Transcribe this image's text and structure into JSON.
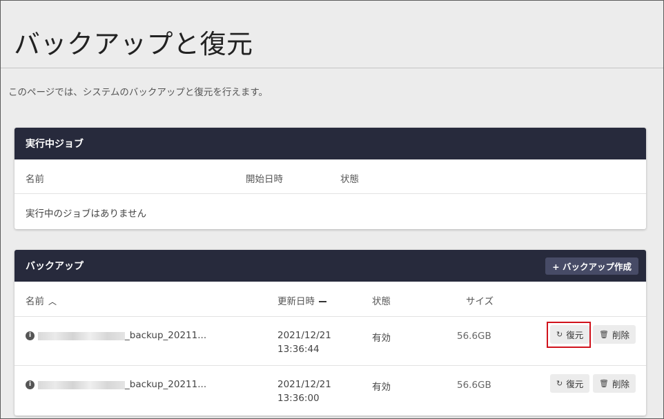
{
  "page": {
    "title": "バックアップと復元",
    "description": "このページでは、システムのバックアップと復元を行えます。"
  },
  "jobs_panel": {
    "title": "実行中ジョブ",
    "columns": [
      "名前",
      "開始日時",
      "状態"
    ],
    "empty_message": "実行中のジョブはありません"
  },
  "backups_panel": {
    "title": "バックアップ",
    "create_button": "+ バックアップ作成",
    "columns": {
      "name": "名前",
      "updated": "更新日時",
      "status": "状態",
      "size": "サイズ"
    },
    "rows": [
      {
        "name_suffix": "_backup_20211...",
        "date": "2021/12/21",
        "time": "13:36:44",
        "status": "有効",
        "size": "56.6GB",
        "restore_label": "復元",
        "delete_label": "削除"
      },
      {
        "name_suffix": "_backup_20211...",
        "date": "2021/12/21",
        "time": "13:36:00",
        "status": "有効",
        "size": "56.6GB",
        "restore_label": "復元",
        "delete_label": "削除"
      }
    ]
  },
  "icons": {
    "sort_asc": "chevron-up-icon",
    "sort_neutral": "dash-icon",
    "info": "info-icon",
    "restore": "restore-icon",
    "delete": "trash-icon"
  },
  "colors": {
    "panel_header": "#272a3c",
    "create_button": "#474b66",
    "highlight": "#d0121b",
    "background": "#ececec"
  }
}
